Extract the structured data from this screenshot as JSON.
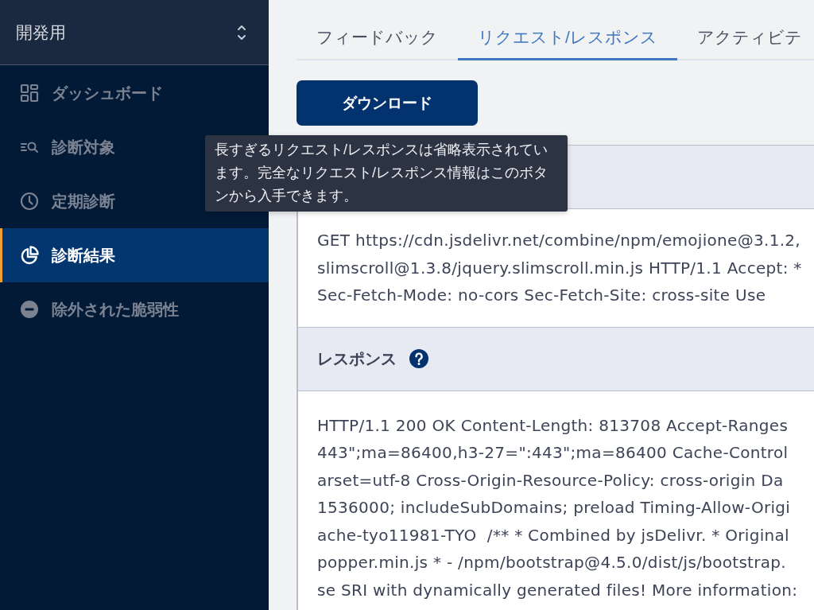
{
  "sidebar": {
    "project_selector": {
      "label": "開発用"
    },
    "items": [
      {
        "label": "ダッシュボード",
        "selected": false
      },
      {
        "label": "診断対象",
        "selected": false
      },
      {
        "label": "定期診断",
        "selected": false
      },
      {
        "label": "診断結果",
        "selected": true
      },
      {
        "label": "除外された脆弱性",
        "selected": false
      }
    ]
  },
  "tabs": [
    {
      "label": "フィードバック",
      "selected": false
    },
    {
      "label": "リクエスト/レスポンス",
      "selected": true
    },
    {
      "label": "アクティビテ",
      "selected": false
    }
  ],
  "download_button": {
    "label": "ダウンロード"
  },
  "tooltip": {
    "text": "長すぎるリクエスト/レスポンスは省略表示されています。完全なリクエスト/レスポンス情報はこのボタンから入手できます。"
  },
  "sections": [
    {
      "lines": [
        "GET https://cdn.jsdelivr.net/combine/npm/emojione@3.1.2,",
        "slimscroll@1.3.8/jquery.slimscroll.min.js HTTP/1.1 Accept: *",
        "Sec-Fetch-Mode: no-cors Sec-Fetch-Site: cross-site Use"
      ]
    },
    {
      "title": "レスポンス",
      "lines": [
        "HTTP/1.1 200 OK Content-Length: 813708 Accept-Ranges",
        "443\";ma=86400,h3-27=\":443\";ma=86400 Cache-Control",
        "arset=utf-8 Cross-Origin-Resource-Policy: cross-origin Da",
        "1536000; includeSubDomains; preload Timing-Allow-Origi",
        "ache-tyo11981-TYO  /** * Combined by jsDelivr. * Original",
        "popper.min.js * - /npm/bootstrap@4.5.0/dist/js/bootstrap.",
        "se SRI with dynamically generated files! More information:"
      ]
    }
  ]
}
